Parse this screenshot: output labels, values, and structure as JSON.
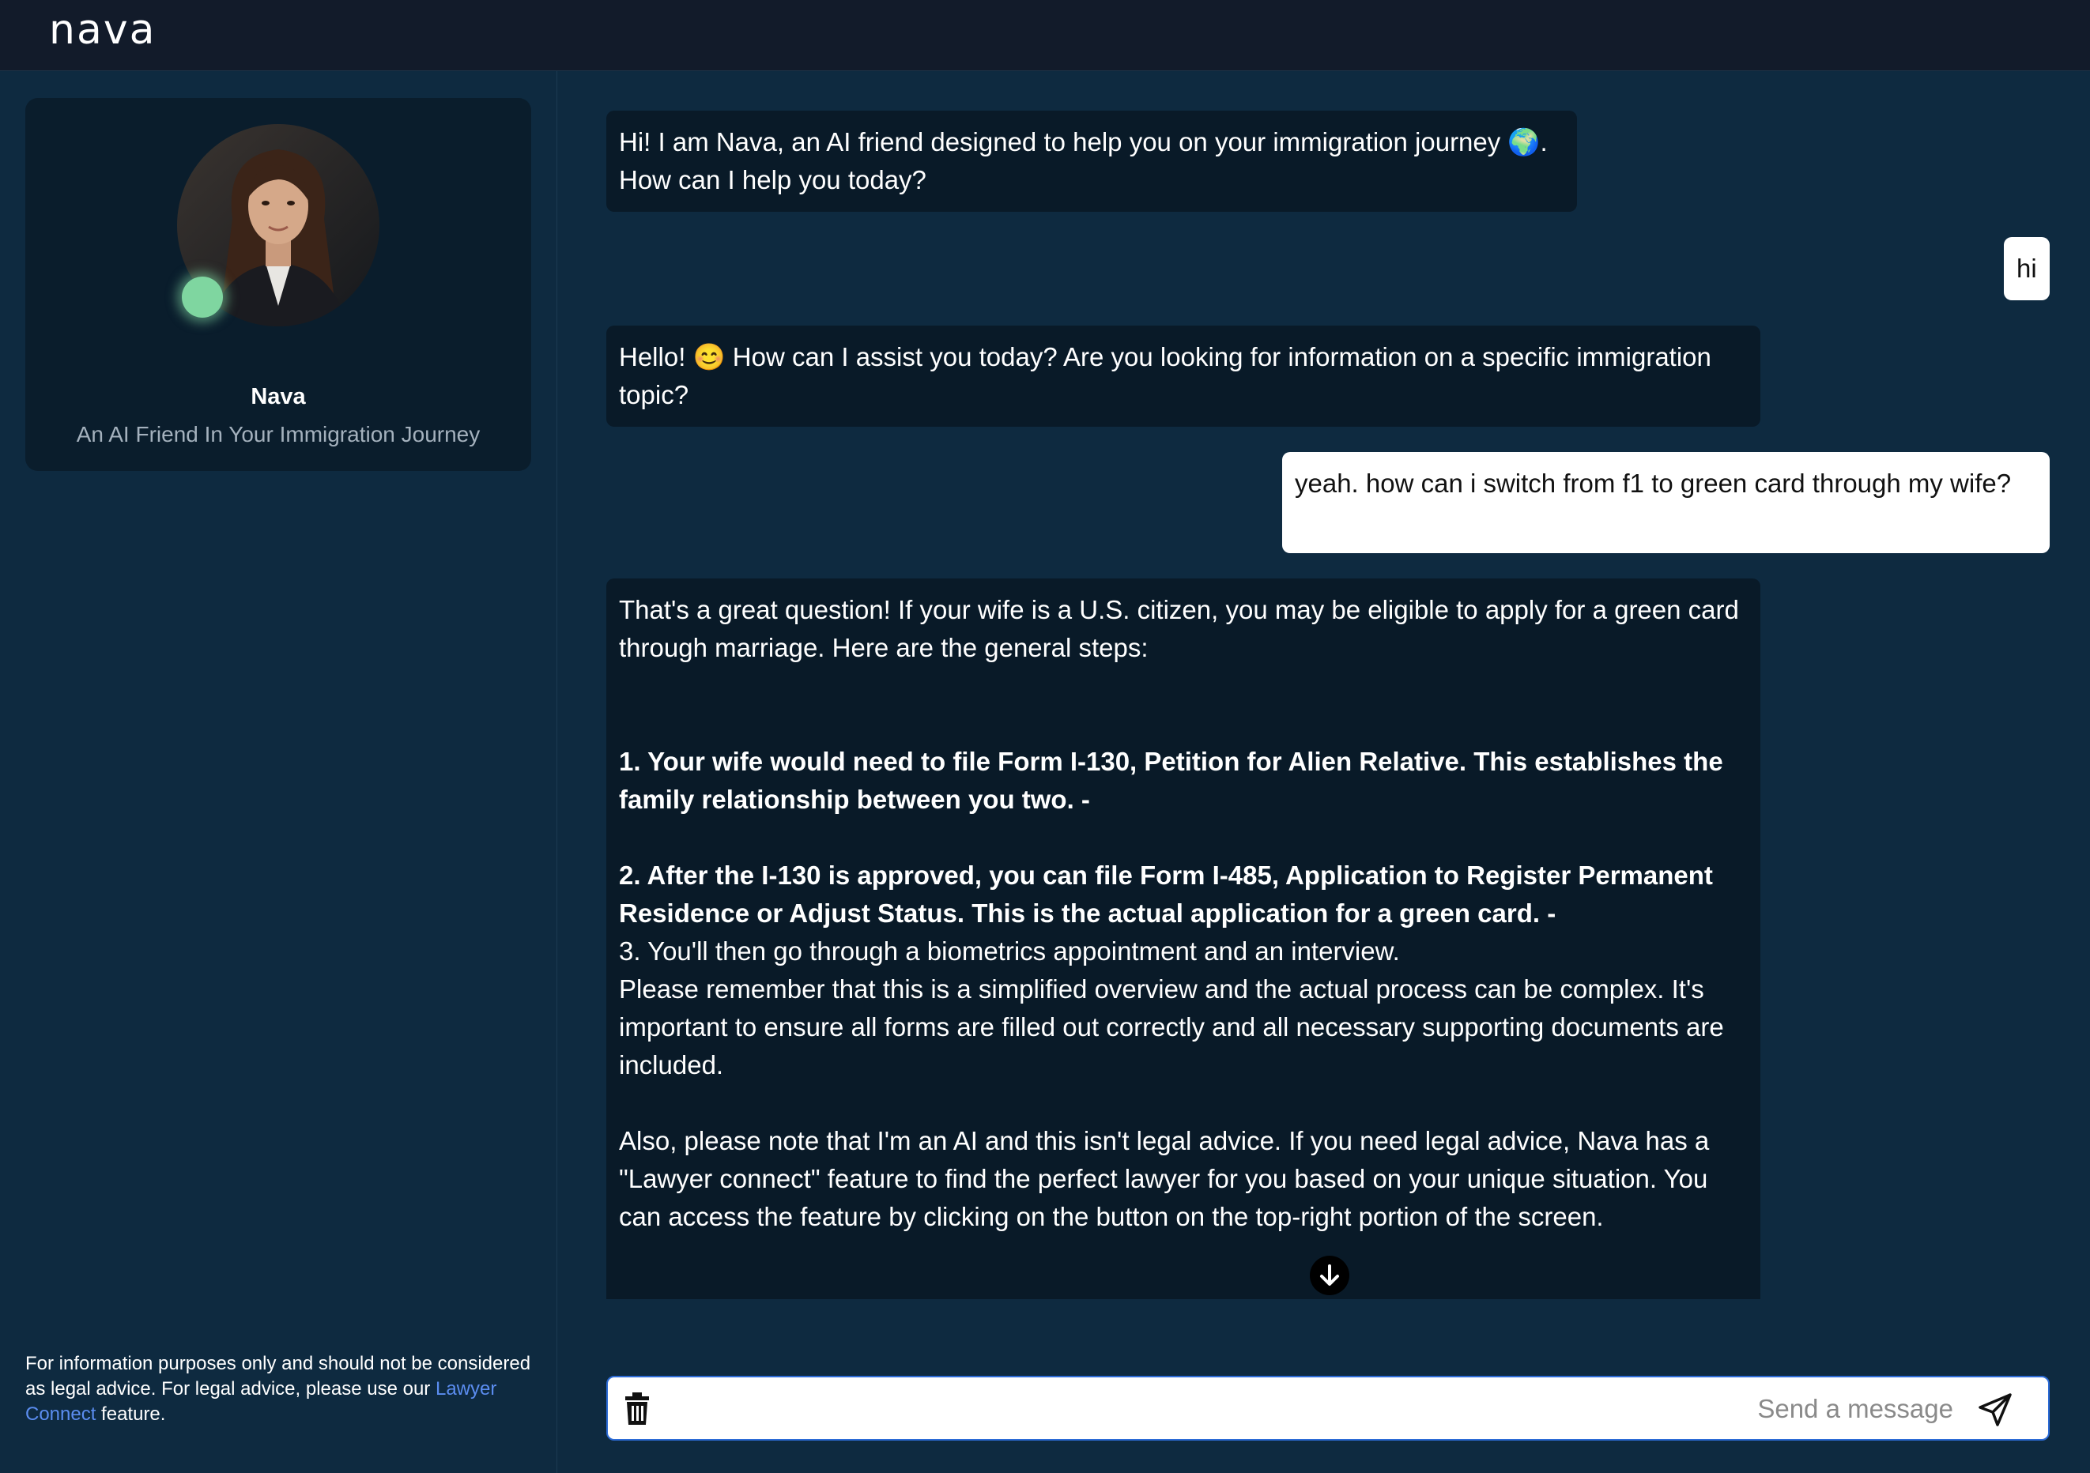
{
  "header": {
    "logo": "nava"
  },
  "profile": {
    "name": "Nava",
    "subtitle": "An AI Friend In Your Immigration Journey"
  },
  "disclaimer": {
    "text_before": "For information purposes only and should not be considered as legal advice. For legal advice, please use our ",
    "link": "Lawyer Connect",
    "text_after": " feature."
  },
  "messages": [
    {
      "role": "bot",
      "lines": [
        "Hi! I am Nava, an AI friend designed to help you on your immigration journey 🌍.",
        "How can I help you today?"
      ]
    },
    {
      "role": "user",
      "text": "hi"
    },
    {
      "role": "bot",
      "text": "Hello! 😊 How can I assist you today? Are you looking for information on a specific immigration topic?"
    },
    {
      "role": "user",
      "text": "yeah. how can i switch from f1 to green card through my wife?"
    },
    {
      "role": "bot",
      "intro": "That's a great question! If your wife is a U.S. citizen, you may be eligible to apply for a green card through marriage. Here are the general steps:",
      "step1": "1. Your wife would need to file Form I-130, Petition for Alien Relative. This establishes the family relationship between you two. -",
      "step2": "2. After the I-130 is approved, you can file Form I-485, Application to Register Permanent Residence or Adjust Status. This is the actual application for a green card. -",
      "step3": "3. You'll then go through a biometrics appointment and an interview.",
      "note": "Please remember that this is a simplified overview and the actual process can be complex. It's important to ensure all forms are filled out correctly and all necessary supporting documents are included.",
      "legal": "Also, please note that I'm an AI and this isn't legal advice. If you need legal advice, Nava has a \"Lawyer connect\" feature to find the perfect lawyer for you based on your unique situation. You can access the feature by clicking on the button on the top-right portion of the screen."
    }
  ],
  "composer": {
    "placeholder": "Send a message"
  },
  "icons": {
    "trash": "trash-icon",
    "send": "send-icon",
    "scroll": "arrow-down-icon"
  },
  "colors": {
    "background": "#0e2a40",
    "topbar": "#121b2a",
    "bot_bubble": "#091a28",
    "user_bubble": "#ffffff",
    "link": "#5b8df0",
    "status": "#7fd6a0",
    "input_border": "#2c6bd6"
  }
}
